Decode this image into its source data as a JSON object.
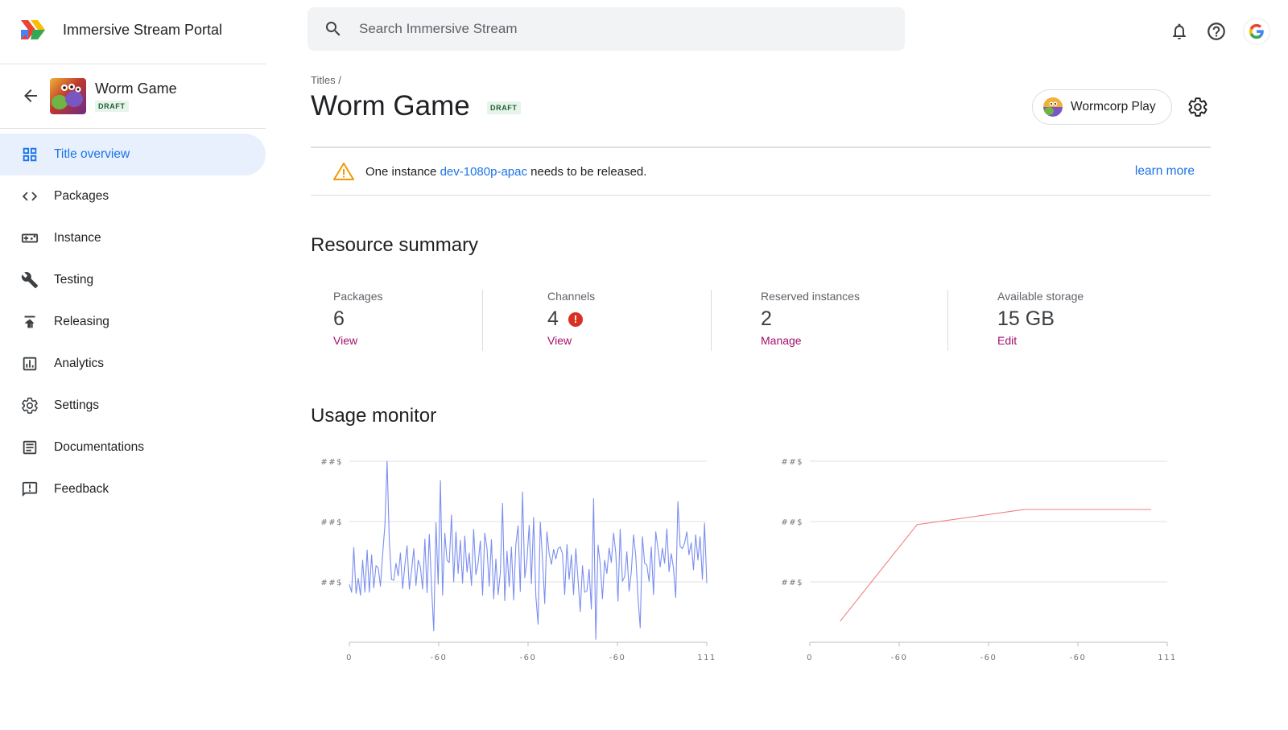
{
  "app": {
    "title": "Immersive Stream Portal"
  },
  "search": {
    "placeholder": "Search Immersive Stream"
  },
  "topbar": {
    "icons": [
      "bell-icon",
      "help-icon",
      "google-account-icon"
    ]
  },
  "title_panel": {
    "name": "Worm Game",
    "badge": "DRAFT"
  },
  "sidebar": {
    "items": [
      {
        "label": "Title overview",
        "icon": "dashboard-icon",
        "active": true
      },
      {
        "label": "Packages",
        "icon": "code-icon",
        "active": false
      },
      {
        "label": "Instance",
        "icon": "gamepad-icon",
        "active": false
      },
      {
        "label": "Testing",
        "icon": "wrench-icon",
        "active": false
      },
      {
        "label": "Releasing",
        "icon": "publish-icon",
        "active": false
      },
      {
        "label": "Analytics",
        "icon": "analytics-icon",
        "active": false
      },
      {
        "label": "Settings",
        "icon": "gear-icon",
        "active": false
      },
      {
        "label": "Documentations",
        "icon": "document-icon",
        "active": false
      },
      {
        "label": "Feedback",
        "icon": "feedback-icon",
        "active": false
      }
    ]
  },
  "header": {
    "breadcrumb": "Titles /",
    "title": "Worm Game",
    "badge": "DRAFT",
    "org_name": "Wormcorp Play"
  },
  "alert": {
    "prefix": "One instance ",
    "link": "dev-1080p-apac",
    "suffix": " needs to be released.",
    "action": "learn more"
  },
  "resource_summary": {
    "title": "Resource summary",
    "stats": [
      {
        "label": "Packages",
        "value": "6",
        "link": "View",
        "error": false
      },
      {
        "label": "Channels",
        "value": "4",
        "link": "View",
        "error": true
      },
      {
        "label": "Reserved instances",
        "value": "2",
        "link": "Manage",
        "error": false
      },
      {
        "label": "Available storage",
        "value": "15 GB",
        "link": "Edit",
        "error": false
      }
    ]
  },
  "usage_monitor": {
    "title": "Usage monitor"
  },
  "colors": {
    "accent": "#1a73e8",
    "link_magenta": "#a50e6b",
    "active_nav_bg": "#e8f0fe",
    "series_blue": "#7b8ef0",
    "series_red": "#f08080",
    "error": "#d93025"
  },
  "chart_data": [
    {
      "type": "line",
      "x_ticks": [
        "0",
        "-60",
        "-60",
        "-60",
        "111"
      ],
      "y_ticks": [
        "##$",
        "##$",
        "##$"
      ],
      "ylim": [
        0,
        3
      ],
      "grid": true,
      "series": [
        {
          "color": "#7b8ef0",
          "values": [
            0.96,
            0.83,
            1.57,
            0.81,
            1.06,
            0.78,
            1.36,
            0.83,
            1.53,
            0.83,
            1.45,
            0.9,
            1.27,
            1.23,
            0.93,
            1.47,
            1.93,
            3.0,
            1.68,
            1.04,
            1.03,
            1.31,
            1.1,
            1.48,
            0.89,
            1.27,
            1.6,
            0.88,
            1.18,
            1.55,
            0.94,
            1.36,
            1.25,
            0.88,
            1.71,
            0.82,
            1.79,
            0.95,
            0.19,
            1.98,
            0.96,
            2.68,
            0.78,
            1.81,
            1.36,
            1.32,
            2.11,
            1.0,
            1.83,
            1.14,
            1.69,
            0.98,
            1.76,
            1.16,
            1.48,
            0.94,
            1.87,
            1.12,
            1.32,
            1.68,
            0.78,
            1.81,
            1.55,
            0.93,
            1.7,
            0.72,
            1.38,
            0.79,
            1.15,
            2.3,
            0.69,
            1.51,
            0.92,
            1.58,
            0.7,
            1.62,
            1.93,
            0.84,
            2.49,
            1.07,
            1.36,
            1.94,
            0.97,
            2.07,
            0.76,
            0.3,
            1.99,
            1.38,
            0.64,
            1.83,
            1.47,
            1.29,
            1.54,
            1.38,
            1.55,
            1.58,
            1.47,
            0.79,
            1.62,
            1.04,
            1.45,
            0.79,
            1.55,
            1.05,
            0.51,
            1.27,
            0.83,
            0.85,
            1.21,
            0.55,
            2.38,
            0.05,
            1.61,
            1.3,
            0.72,
            1.36,
            1.14,
            1.56,
            1.32,
            1.81,
            1.49,
            0.68,
            1.87,
            1.01,
            1.09,
            1.5,
            0.85,
            1.16,
            1.78,
            1.42,
            0.75,
            0.24,
            1.75,
            1.31,
            1.28,
            1.01,
            1.58,
            0.79,
            1.83,
            1.56,
            1.25,
            1.56,
            1.31,
            1.88,
            1.17,
            1.47,
            1.23,
            0.74,
            2.33,
            1.59,
            1.55,
            1.64,
            1.83,
            1.45,
            1.65,
            1.2,
            1.78,
            1.36,
            1.75,
            1.04,
            1.97,
            0.98
          ]
        }
      ]
    },
    {
      "type": "line",
      "x_ticks": [
        "0",
        "-60",
        "-60",
        "-60",
        "111"
      ],
      "y_ticks": [
        "##$",
        "##$",
        "##$"
      ],
      "ylim": [
        0,
        3
      ],
      "grid": true,
      "series": [
        {
          "color": "#f08080",
          "x": [
            0.085,
            0.3,
            0.6,
            0.955
          ],
          "values": [
            0.35,
            1.95,
            2.2,
            2.2
          ]
        }
      ]
    }
  ]
}
